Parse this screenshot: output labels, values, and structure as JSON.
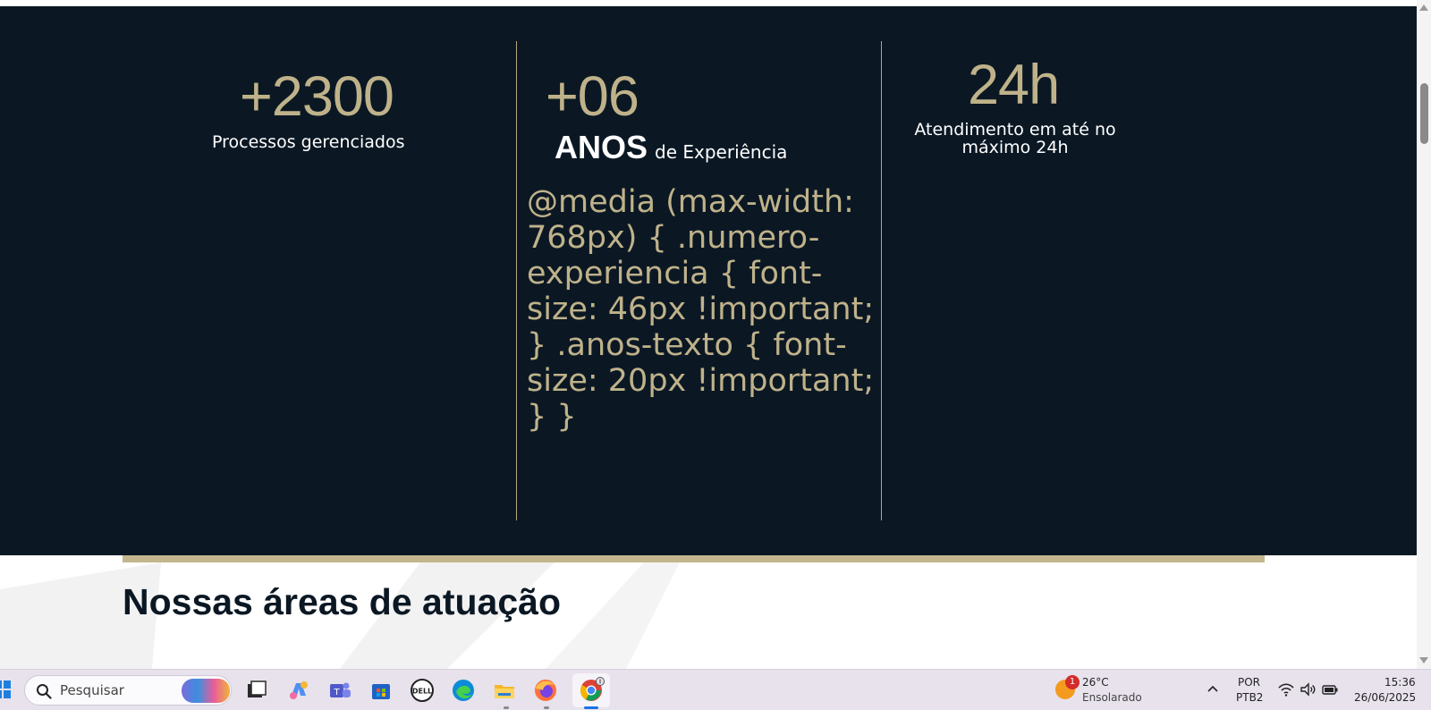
{
  "stats": {
    "processos": {
      "number": "+2300",
      "label": "Processos gerenciados"
    },
    "experiencia": {
      "number": "+06",
      "anos": "ANOS",
      "label": "de Experiência"
    },
    "atendimento": {
      "number": "24h",
      "label_line1": "Atendimento em até no",
      "label_line2": "máximo 24h"
    },
    "leaked_css": "@media (max-width: 768px) { .numero-experiencia { font-size: 46px !important; } .anos-texto { font-size: 20px !important; } }"
  },
  "section": {
    "title": "Nossas áreas de atuação"
  },
  "colors": {
    "band": "#0b1824",
    "gold": "#bfb28a",
    "bar": "#c3b58c"
  },
  "taskbar": {
    "search_placeholder": "Pesquisar",
    "apps": [
      "task-view-icon",
      "copilot-icon",
      "teams-icon",
      "store-icon",
      "dell-icon",
      "edge-icon",
      "file-explorer-icon",
      "firefox-icon",
      "chrome-icon"
    ],
    "weather": {
      "badge": "1",
      "temp": "26°C",
      "desc": "Ensolarado"
    },
    "language": {
      "top": "POR",
      "bottom": "PTB2"
    },
    "clock": {
      "time": "15:36",
      "date": "26/06/2025"
    }
  }
}
